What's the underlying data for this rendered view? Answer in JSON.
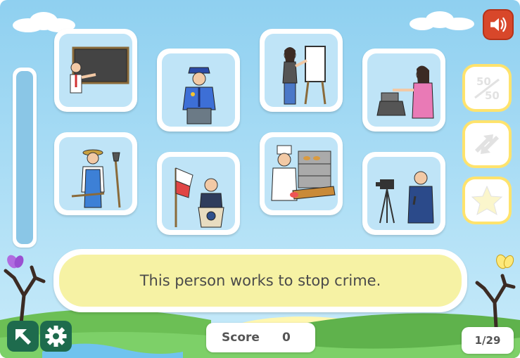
{
  "clue": {
    "text": "This person works to stop crime."
  },
  "score": {
    "label": "Score",
    "value": "0"
  },
  "counter": {
    "text": "1/29"
  },
  "progress": {
    "fraction": 0.0
  },
  "cards": [
    {
      "id": "teacher",
      "icon": "teacher-at-chalkboard-icon"
    },
    {
      "id": "police-officer",
      "icon": "police-officer-icon"
    },
    {
      "id": "painter",
      "icon": "painter-at-easel-icon"
    },
    {
      "id": "cashier",
      "icon": "cashier-at-register-icon"
    },
    {
      "id": "farmer",
      "icon": "farmer-with-tools-icon"
    },
    {
      "id": "politician",
      "icon": "politician-at-podium-icon"
    },
    {
      "id": "baker",
      "icon": "baker-with-bread-icon"
    },
    {
      "id": "reporter",
      "icon": "reporter-with-camera-icon"
    }
  ],
  "lifelines": [
    {
      "id": "fifty-fifty",
      "icon": "fifty-fifty-icon",
      "label": "50/50"
    },
    {
      "id": "swap",
      "icon": "swap-arrows-icon"
    },
    {
      "id": "star",
      "icon": "star-icon"
    }
  ],
  "buttons": {
    "sound": "speaker-icon",
    "exit": "exit-arrow-icon",
    "settings": "gear-icon"
  },
  "colors": {
    "sky": "#8fd0f0",
    "card_inner": "#bfe4f7",
    "clue_fill": "#f6f2a4",
    "lifeline_border": "#ffe36d",
    "sound_button": "#d8472a",
    "corner_button": "#1e6b4d"
  }
}
